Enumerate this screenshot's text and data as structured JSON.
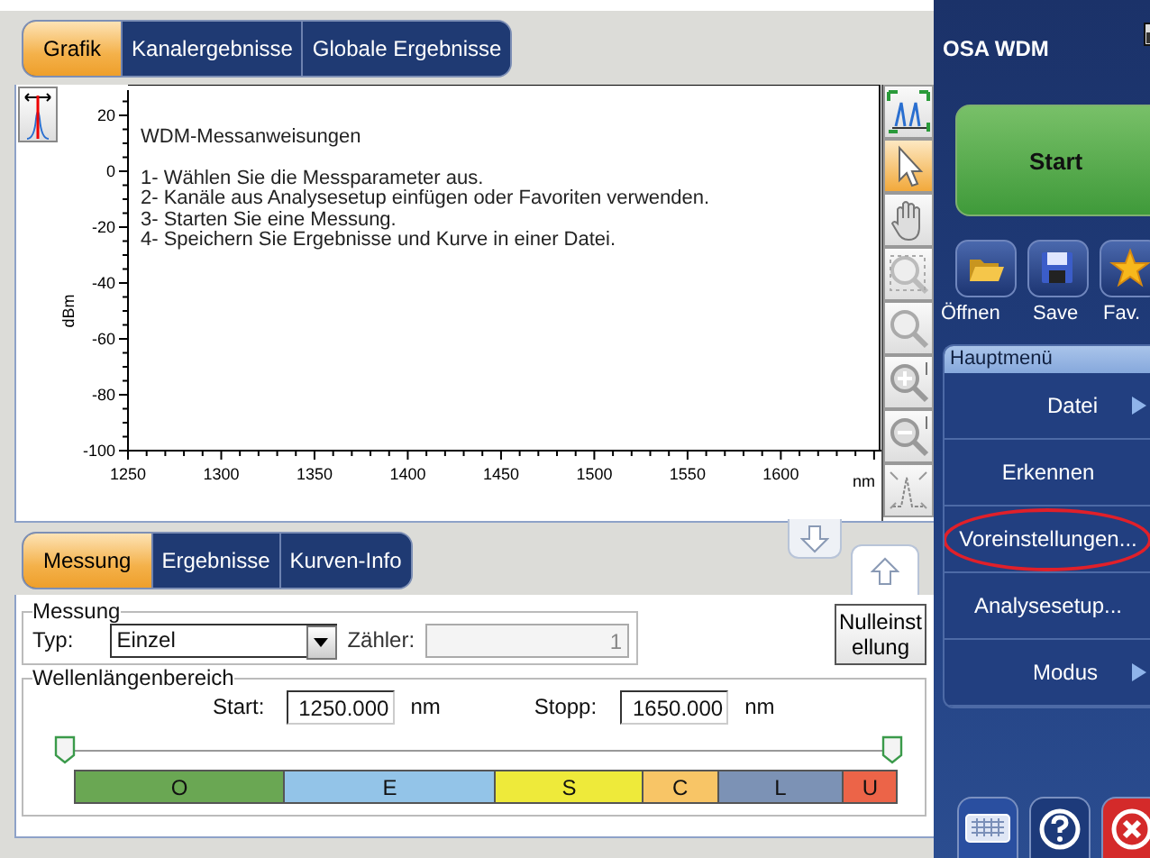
{
  "main_tabs": [
    {
      "label": "Grafik",
      "selected": true
    },
    {
      "label": "Kanalergebnisse",
      "selected": false
    },
    {
      "label": "Globale Ergebnisse",
      "selected": false
    }
  ],
  "graph": {
    "instructions": {
      "title": "WDM-Messanweisungen",
      "steps": [
        "1- Wählen Sie die Messparameter aus.",
        "2- Kanäle aus Analysesetup einfügen oder Favoriten verwenden.",
        "3- Starten Sie eine Messung.",
        "4- Speichern Sie Ergebnisse und Kurve in einer Datei."
      ]
    },
    "chart_data": {
      "type": "line",
      "xlabel": "nm",
      "ylabel": "dBm",
      "xlim": [
        1250,
        1652
      ],
      "ylim": [
        -100,
        29
      ],
      "xticks": [
        1250,
        1300,
        1350,
        1400,
        1450,
        1500,
        1550,
        1600
      ],
      "yticks": [
        -100,
        -80,
        -60,
        -40,
        -20,
        0,
        20
      ]
    },
    "tools": [
      {
        "kind": "fit",
        "selected": false
      },
      {
        "kind": "pointer",
        "selected": true
      },
      {
        "kind": "pan",
        "selected": false
      },
      {
        "kind": "zoom-area",
        "selected": false
      },
      {
        "kind": "zoom-reset",
        "selected": false
      },
      {
        "kind": "zoom-in",
        "selected": false
      },
      {
        "kind": "zoom-out",
        "selected": false
      },
      {
        "kind": "peak",
        "selected": false
      }
    ]
  },
  "panel_tabs": [
    {
      "label": "Messung",
      "selected": true
    },
    {
      "label": "Ergebnisse",
      "selected": false
    },
    {
      "label": "Kurven-Info",
      "selected": false
    }
  ],
  "measurement": {
    "legend": "Messung",
    "type_label": "Typ:",
    "type_value": "Einzel",
    "counter_label": "Zähler:",
    "counter_value": "1",
    "counter_disabled": true
  },
  "reset_button": "Nulleinstellung",
  "wavelength_range": {
    "legend": "Wellenlängenbereich",
    "start_label": "Start:",
    "start_value": "1250.000",
    "start_unit": "nm",
    "stop_label": "Stopp:",
    "stop_value": "1650.000",
    "stop_unit": "nm",
    "bands": [
      {
        "label": "O",
        "color": "#6aa753"
      },
      {
        "label": "E",
        "color": "#93c4e8"
      },
      {
        "label": "S",
        "color": "#eeea3a"
      },
      {
        "label": "C",
        "color": "#f8c566"
      },
      {
        "label": "L",
        "color": "#7c92b5"
      },
      {
        "label": "U",
        "color": "#ec6448"
      }
    ]
  },
  "sidebar": {
    "title": "OSA WDM",
    "start_button": "Start",
    "quick_buttons": [
      {
        "kind": "open",
        "label": "Öffnen"
      },
      {
        "kind": "save",
        "label": "Save"
      },
      {
        "kind": "favorite",
        "label": "Fav."
      }
    ],
    "menu_title": "Hauptmenü",
    "menu": [
      {
        "label": "Datei",
        "submenu": true,
        "highlighted": false
      },
      {
        "label": "Erkennen",
        "submenu": false,
        "highlighted": false
      },
      {
        "label": "Voreinstellungen...",
        "submenu": false,
        "highlighted": true
      },
      {
        "label": "Analysesetup...",
        "submenu": false,
        "highlighted": false
      },
      {
        "label": "Modus",
        "submenu": true,
        "highlighted": false
      }
    ],
    "bottom_buttons": [
      {
        "kind": "keyboard"
      },
      {
        "kind": "help"
      },
      {
        "kind": "close"
      }
    ]
  }
}
